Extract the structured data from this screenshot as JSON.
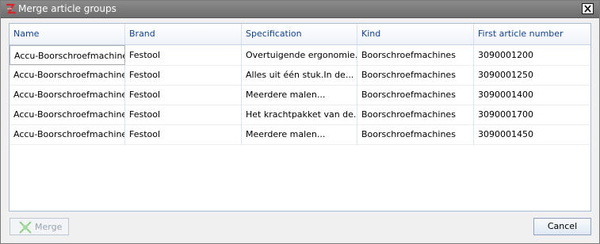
{
  "window": {
    "title": "Merge article groups",
    "close_glyph": "✕",
    "app_icon": "festool-icon"
  },
  "grid": {
    "columns": [
      "Name",
      "Brand",
      "Specification",
      "Kind",
      "First article number"
    ],
    "rows": [
      [
        "Accu-Boorschroefmachine",
        "Festool",
        "Overtuigende ergonomie...",
        "Boorschroefmachines",
        "3090001200"
      ],
      [
        "Accu-Boorschroefmachine",
        "Festool",
        "Alles uit één stuk.In de...",
        "Boorschroefmachines",
        "3090001250"
      ],
      [
        "Accu-Boorschroefmachine",
        "Festool",
        "Meerdere malen...",
        "Boorschroefmachines",
        "3090001400"
      ],
      [
        "Accu-Boorschroefmachine",
        "Festool",
        "Het krachtpakket van de...",
        "Boorschroefmachines",
        "3090001700"
      ],
      [
        "Accu-Boorschroefmachine",
        "Festool",
        "Meerdere malen...",
        "Boorschroefmachines",
        "3090001450"
      ]
    ]
  },
  "footer": {
    "merge_label": "Merge",
    "merge_icon": "merge-arrows-icon",
    "merge_enabled": false,
    "cancel_label": "Cancel"
  },
  "colors": {
    "titlebar": "#7d7d7d",
    "header_text": "#15428b",
    "grid_border": "#a9bcd1"
  }
}
